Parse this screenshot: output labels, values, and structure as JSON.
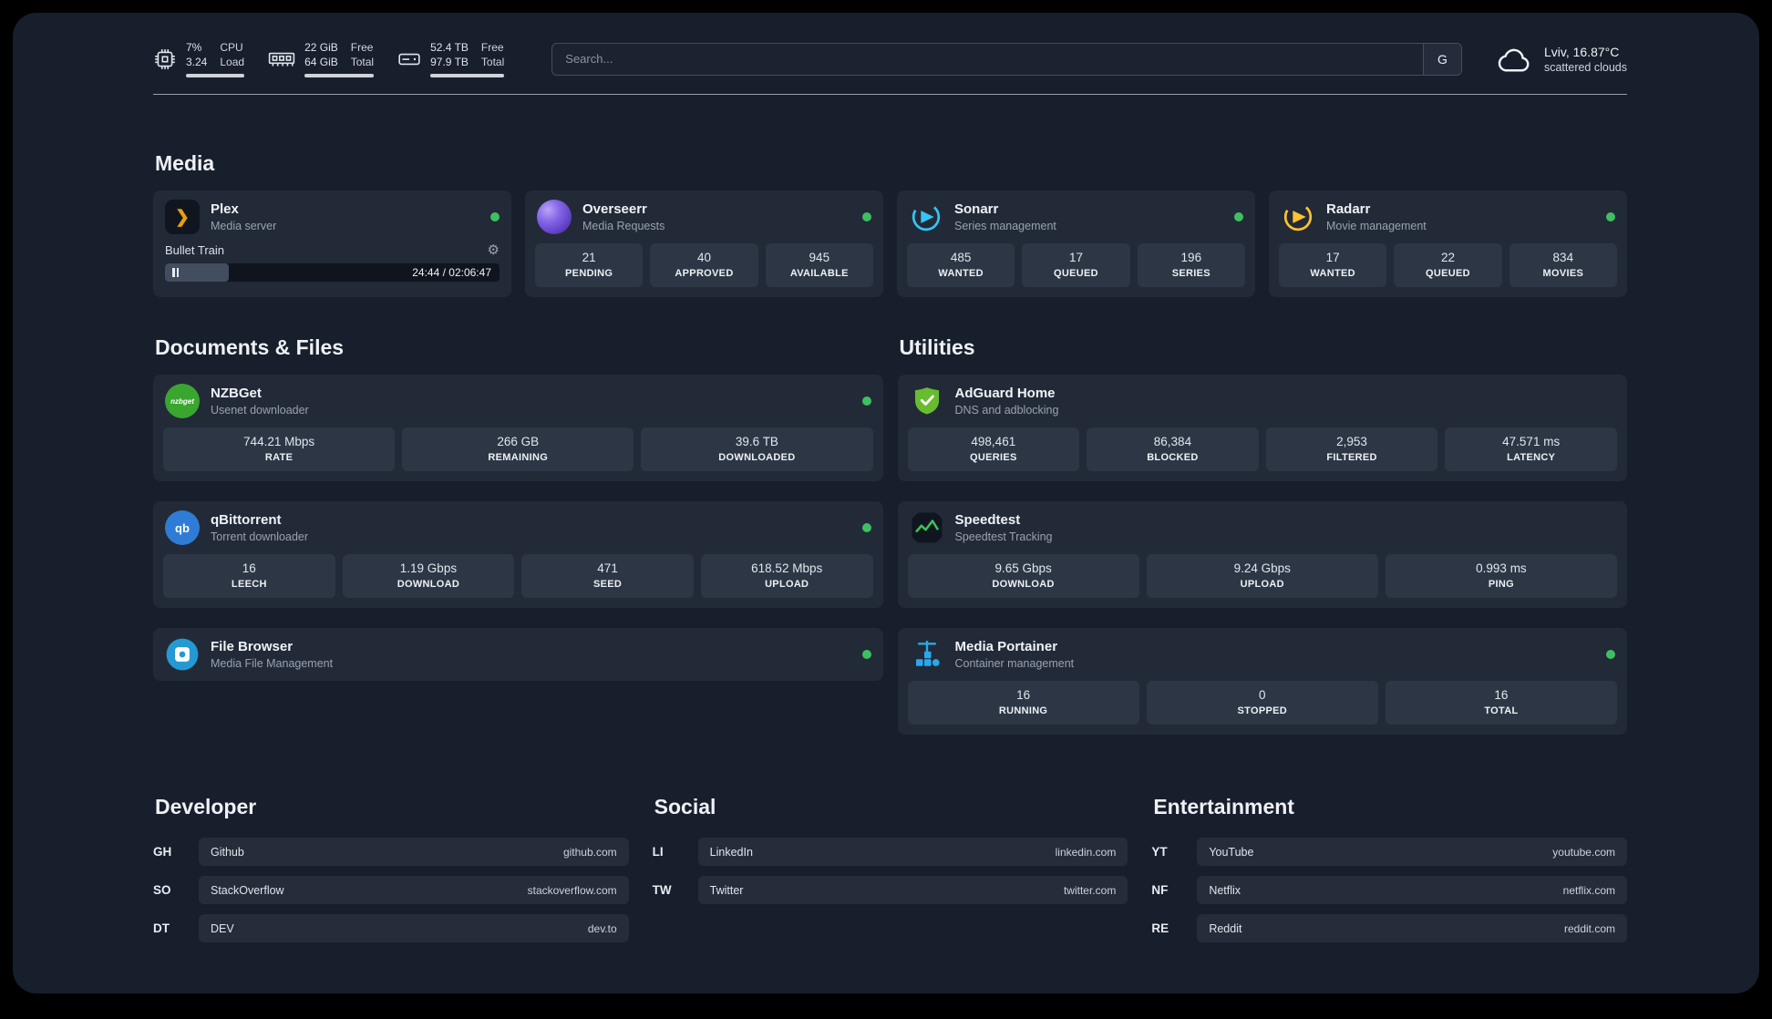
{
  "topbar": {
    "cpu": {
      "value": "7%",
      "load": "3.24",
      "label1": "CPU",
      "label2": "Load"
    },
    "ram": {
      "value1": "22 GiB",
      "value2": "64 GiB",
      "label1": "Free",
      "label2": "Total"
    },
    "disk": {
      "value1": "52.4 TB",
      "value2": "97.9 TB",
      "label1": "Free",
      "label2": "Total"
    },
    "search": {
      "placeholder": "Search...",
      "button": "G"
    },
    "weather": {
      "location": "Lviv, 16.87°C",
      "condition": "scattered clouds"
    }
  },
  "media": {
    "title": "Media",
    "plex": {
      "name": "Plex",
      "subtitle": "Media server",
      "now_playing": {
        "title": "Bullet Train",
        "time": "24:44 / 02:06:47",
        "progress": 19
      }
    },
    "overseerr": {
      "name": "Overseerr",
      "subtitle": "Media Requests",
      "stats": [
        {
          "value": "21",
          "label": "PENDING"
        },
        {
          "value": "40",
          "label": "APPROVED"
        },
        {
          "value": "945",
          "label": "AVAILABLE"
        }
      ]
    },
    "sonarr": {
      "name": "Sonarr",
      "subtitle": "Series management",
      "stats": [
        {
          "value": "485",
          "label": "WANTED"
        },
        {
          "value": "17",
          "label": "QUEUED"
        },
        {
          "value": "196",
          "label": "SERIES"
        }
      ]
    },
    "radarr": {
      "name": "Radarr",
      "subtitle": "Movie management",
      "stats": [
        {
          "value": "17",
          "label": "WANTED"
        },
        {
          "value": "22",
          "label": "QUEUED"
        },
        {
          "value": "834",
          "label": "MOVIES"
        }
      ]
    }
  },
  "documents": {
    "title": "Documents & Files",
    "nzbget": {
      "name": "NZBGet",
      "subtitle": "Usenet downloader",
      "stats": [
        {
          "value": "744.21 Mbps",
          "label": "RATE"
        },
        {
          "value": "266 GB",
          "label": "REMAINING"
        },
        {
          "value": "39.6 TB",
          "label": "DOWNLOADED"
        }
      ]
    },
    "qbittorrent": {
      "name": "qBittorrent",
      "subtitle": "Torrent downloader",
      "stats": [
        {
          "value": "16",
          "label": "LEECH"
        },
        {
          "value": "1.19 Gbps",
          "label": "DOWNLOAD"
        },
        {
          "value": "471",
          "label": "SEED"
        },
        {
          "value": "618.52 Mbps",
          "label": "UPLOAD"
        }
      ]
    },
    "filebrowser": {
      "name": "File Browser",
      "subtitle": "Media File Management"
    }
  },
  "utilities": {
    "title": "Utilities",
    "adguard": {
      "name": "AdGuard Home",
      "subtitle": "DNS and adblocking",
      "stats": [
        {
          "value": "498,461",
          "label": "QUERIES"
        },
        {
          "value": "86,384",
          "label": "BLOCKED"
        },
        {
          "value": "2,953",
          "label": "FILTERED"
        },
        {
          "value": "47.571 ms",
          "label": "LATENCY"
        }
      ]
    },
    "speedtest": {
      "name": "Speedtest",
      "subtitle": "Speedtest Tracking",
      "stats": [
        {
          "value": "9.65 Gbps",
          "label": "DOWNLOAD"
        },
        {
          "value": "9.24 Gbps",
          "label": "UPLOAD"
        },
        {
          "value": "0.993 ms",
          "label": "PING"
        }
      ]
    },
    "portainer": {
      "name": "Media Portainer",
      "subtitle": "Container management",
      "stats": [
        {
          "value": "16",
          "label": "RUNNING"
        },
        {
          "value": "0",
          "label": "STOPPED"
        },
        {
          "value": "16",
          "label": "TOTAL"
        }
      ]
    }
  },
  "bookmarks": {
    "developer": {
      "title": "Developer",
      "items": [
        {
          "abbr": "GH",
          "name": "Github",
          "domain": "github.com"
        },
        {
          "abbr": "SO",
          "name": "StackOverflow",
          "domain": "stackoverflow.com"
        },
        {
          "abbr": "DT",
          "name": "DEV",
          "domain": "dev.to"
        }
      ]
    },
    "social": {
      "title": "Social",
      "items": [
        {
          "abbr": "LI",
          "name": "LinkedIn",
          "domain": "linkedin.com"
        },
        {
          "abbr": "TW",
          "name": "Twitter",
          "domain": "twitter.com"
        }
      ]
    },
    "entertainment": {
      "title": "Entertainment",
      "items": [
        {
          "abbr": "YT",
          "name": "YouTube",
          "domain": "youtube.com"
        },
        {
          "abbr": "NF",
          "name": "Netflix",
          "domain": "netflix.com"
        },
        {
          "abbr": "RE",
          "name": "Reddit",
          "domain": "reddit.com"
        }
      ]
    }
  }
}
